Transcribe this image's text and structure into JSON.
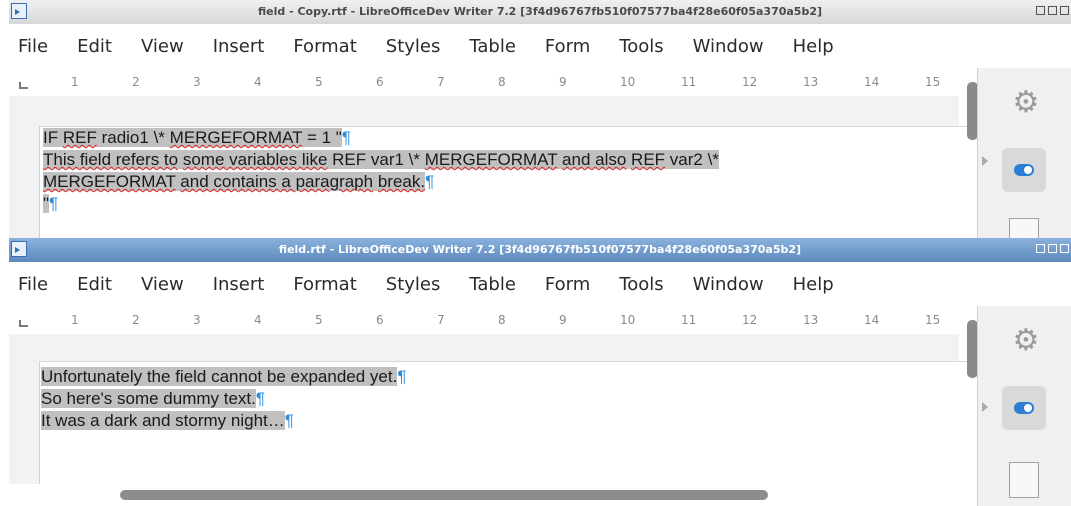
{
  "window1": {
    "title": "field - Copy.rtf - LibreOfficeDev Writer 7.2 [3f4d96767fb510f07577ba4f28e60f05a370a5b2]",
    "menu": [
      "File",
      "Edit",
      "View",
      "Insert",
      "Format",
      "Styles",
      "Table",
      "Form",
      "Tools",
      "Window",
      "Help"
    ],
    "ruler": [
      "1",
      "2",
      "3",
      "4",
      "5",
      "6",
      "7",
      "8",
      "9",
      "10",
      "11",
      "12",
      "13",
      "14",
      "15"
    ],
    "doc": {
      "line1": {
        "a": "IF",
        "b": "REF",
        "c": "radio1",
        "d": "\\*",
        "e": "MERGEFORMAT",
        "f": "= 1 \""
      },
      "line2": {
        "a": "This field refers to",
        "b": "some variables like",
        "c": "REF var1",
        "d": "\\*",
        "e": "MERGEFORMAT",
        "f": "and also",
        "g": "REF",
        "h": "var2 \\*"
      },
      "line3": {
        "a": "MERGEFORMAT",
        "b": "and contains a paragraph",
        "c": "break."
      },
      "line4": {
        "a": "\""
      },
      "pilcrow": "¶"
    }
  },
  "window2": {
    "title": "field.rtf - LibreOfficeDev Writer 7.2 [3f4d96767fb510f07577ba4f28e60f05a370a5b2]",
    "menu": [
      "File",
      "Edit",
      "View",
      "Insert",
      "Format",
      "Styles",
      "Table",
      "Form",
      "Tools",
      "Window",
      "Help"
    ],
    "ruler": [
      "1",
      "2",
      "3",
      "4",
      "5",
      "6",
      "7",
      "8",
      "9",
      "10",
      "11",
      "12",
      "13",
      "14",
      "15"
    ],
    "doc": {
      "line1": "Unfortunately the field cannot be expanded yet.",
      "line2": "So here's some dummy text.",
      "line3": "It was a dark and stormy night…",
      "pilcrow": "¶"
    }
  },
  "sidebar": {
    "gear_icon": "gear-icon",
    "toggle_icon": "properties-toggle-icon",
    "page_icon": "page-icon"
  },
  "colors": {
    "accent": "#2a7fd4",
    "highlight": "#c0c0c0",
    "active_title": "#6d96c8"
  }
}
